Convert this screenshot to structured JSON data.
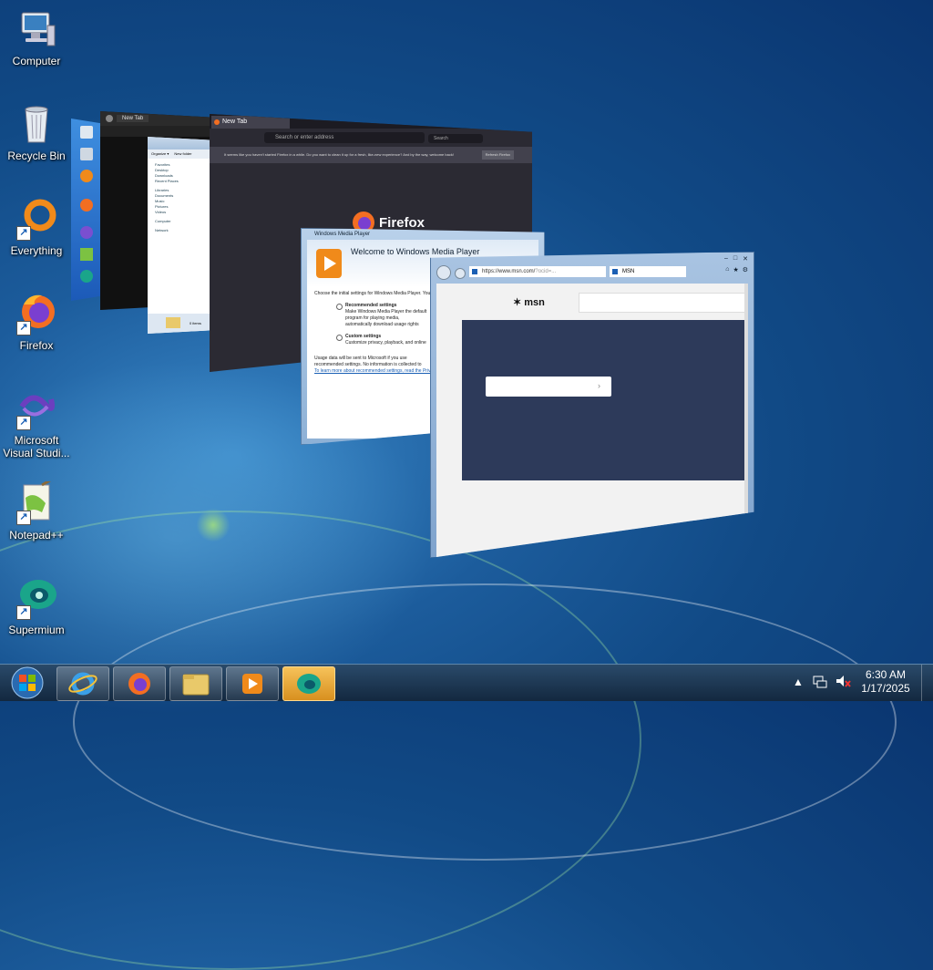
{
  "desktop": {
    "icons": [
      {
        "label": "Computer"
      },
      {
        "label": "Recycle Bin"
      },
      {
        "label": "Everything"
      },
      {
        "label": "Firefox"
      },
      {
        "label": "Microsoft Visual Studi..."
      },
      {
        "label": "Notepad++"
      },
      {
        "label": "Supermium"
      }
    ]
  },
  "windows": {
    "dark_browser": {
      "tab": "New Tab"
    },
    "explorer": {
      "toolbar": [
        "Organize ▾",
        "New folder"
      ],
      "nav": [
        "Favorites",
        "Desktop",
        "Downloads",
        "Recent Places",
        "Libraries",
        "Documents",
        "Music",
        "Pictures",
        "Videos",
        "Computer",
        "Network"
      ],
      "status": "0 items"
    },
    "firefox": {
      "tab": "New Tab",
      "address_placeholder": "Search or enter address",
      "search_placeholder": "Search",
      "notice": "It seems like you haven't started Firefox in a while. Do you want to clean it up for a fresh, like-new experience? And by the way, welcome back!",
      "notice_button": "Refresh Firefox",
      "brand": "Firefox"
    },
    "wmp": {
      "title": "Windows Media Player",
      "heading": "Welcome to Windows Media Player",
      "intro": "Choose the initial settings for Windows Media Player. You",
      "option1_title": "Recommended settings",
      "option1_desc": "Make Windows Media Player the default program for playing media, automatically download usage rights and media information to update your media files, and send usage data from the Player to Microsoft.",
      "option2_title": "Custom settings",
      "option2_desc": "Customize privacy, playback, and online store settings.",
      "footer": "Usage data will be sent to Microsoft if you use recommended settings. No information is collected to identify or contact you.",
      "link": "To learn more about recommended settings, read the Privacy Statement online."
    },
    "ie": {
      "url": "https://www.msn.com/",
      "url_suffix": "?ocid=...",
      "tab": "MSN",
      "logo": "msn"
    }
  },
  "taskbar": {
    "time": "6:30 AM",
    "date": "1/17/2025",
    "buttons": [
      "internet-explorer",
      "firefox",
      "windows-explorer",
      "windows-media-player",
      "supermium"
    ]
  }
}
